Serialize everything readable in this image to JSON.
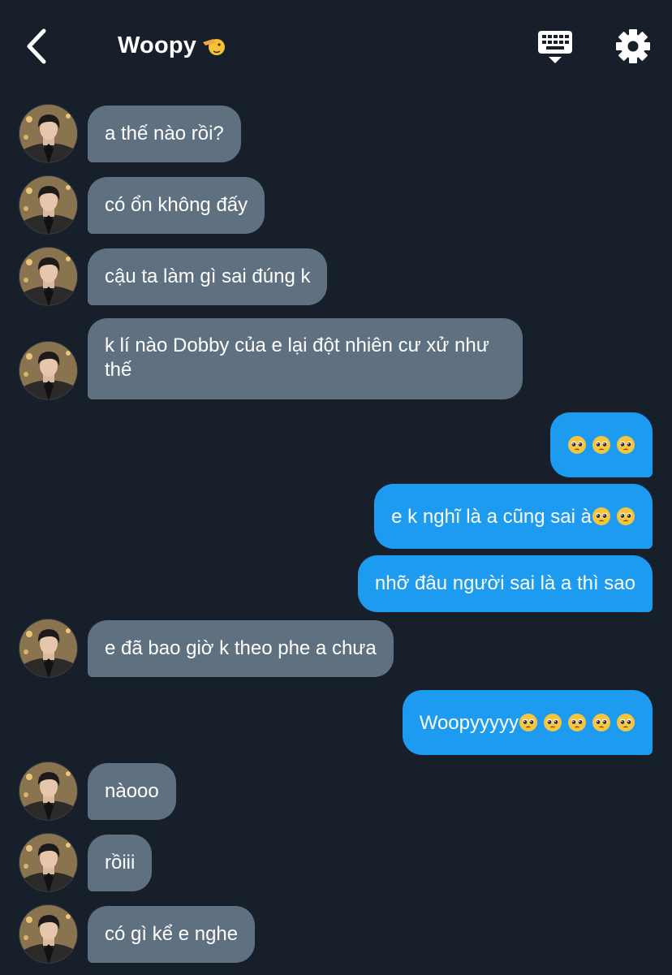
{
  "header": {
    "title": "Woopy",
    "title_emoji": "saluting-face-emoji",
    "back_icon": "chevron-left-icon",
    "keyboard_icon": "keyboard-icon",
    "settings_icon": "gear-icon"
  },
  "colors": {
    "background": "#17202a",
    "incoming_bubble": "#5f7080",
    "outgoing_bubble": "#1d9bf0"
  },
  "messages": [
    {
      "from": "them",
      "text": "a thế nào rồi?"
    },
    {
      "from": "them",
      "text": "có ổn không đấy"
    },
    {
      "from": "them",
      "text": "cậu ta làm gì sai đúng k"
    },
    {
      "from": "them",
      "text": "k lí nào Dobby của e lại đột nhiên cư xử như thế"
    },
    {
      "from": "me",
      "text": "",
      "emoji_count": 3,
      "emoji": "pleading-face-emoji"
    },
    {
      "from": "me",
      "text": "e k nghĩ là a cũng sai à",
      "emoji_count": 2,
      "emoji": "pleading-face-emoji"
    },
    {
      "from": "me",
      "text": "nhỡ đâu người sai là a thì sao"
    },
    {
      "from": "them",
      "text": "e đã bao giờ k theo phe a chưa"
    },
    {
      "from": "me",
      "text": "Woopyyyyy",
      "emoji_count": 5,
      "emoji": "pleading-face-emoji"
    },
    {
      "from": "them",
      "text": "nàooo"
    },
    {
      "from": "them",
      "text": "rồiii"
    },
    {
      "from": "them",
      "text": "có gì kể e nghe"
    }
  ]
}
